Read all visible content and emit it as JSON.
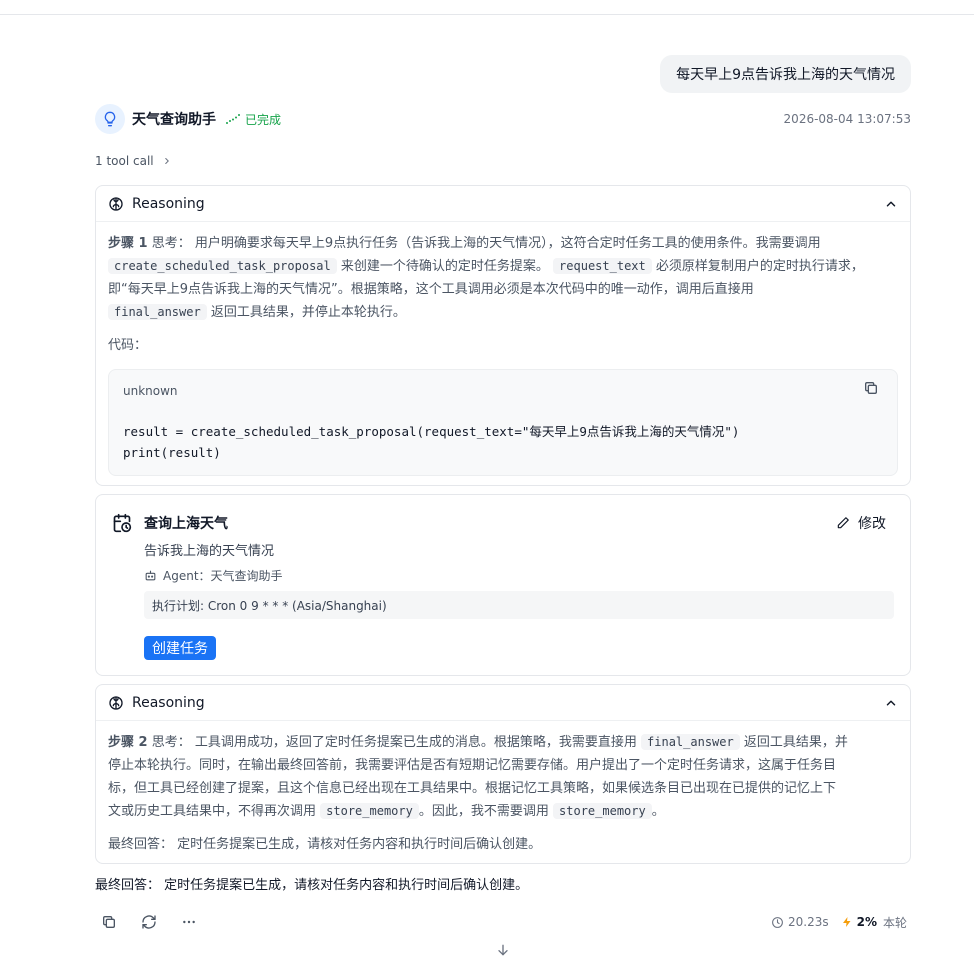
{
  "user_message": "每天早上9点告诉我上海的天气情况",
  "bot": {
    "name": "天气查询助手",
    "status": "已完成",
    "timestamp": "2026-08-04 13:07:53",
    "avatar_icon": "lightbulb-icon"
  },
  "tool_call": {
    "label": "1 tool call"
  },
  "reasoning1": {
    "title": "Reasoning",
    "step_label": "步骤 1",
    "think_label": "思考：",
    "p1": "用户明确要求每天早上9点执行任务（告诉我上海的天气情况），这符合定时任务工具的使用条件。我需要调用",
    "code1": "create_scheduled_task_proposal",
    "p2": "来创建一个待确认的定时任务提案。",
    "code2": "request_text",
    "p3": "必须原样复制用户的定时执行请求，",
    "p4": "即“每天早上9点告诉我上海的天气情况”。根据策略，这个工具调用必须是本次代码中的唯一动作，调用后直接用",
    "code3": "final_answer",
    "p5": "返回工具结果，并停止本轮执行。",
    "code_label": "代码：",
    "code_lang": "unknown",
    "code_line1": "result = create_scheduled_task_proposal(request_text=\"每天早上9点告诉我上海的天气情况\")",
    "code_line2": "print(result)"
  },
  "task": {
    "title": "查询上海天气",
    "edit_label": "修改",
    "description": "告诉我上海的天气情况",
    "agent": "Agent：天气查询助手",
    "schedule": "执行计划: Cron 0 9 * * * (Asia/Shanghai)",
    "create_label": "创建任务"
  },
  "reasoning2": {
    "title": "Reasoning",
    "step_label": "步骤 2",
    "think_label": "思考：",
    "p1": "工具调用成功，返回了定时任务提案已生成的消息。根据策略，我需要直接用",
    "code1": "final_answer",
    "p2": "返回工具结果，并",
    "p3": "停止本轮执行。同时，在输出最终回答前，我需要评估是否有短期记忆需要存储。用户提出了一个定时任务请求，这属于任务目",
    "p4": "标，但工具已经创建了提案，且这个信息已经出现在工具结果中。根据记忆工具策略，如果候选条目已出现在已提供的记忆上下",
    "p5": "文或历史工具结果中，不得再次调用",
    "code2": "store_memory",
    "p6": "。因此，我不需要调用",
    "code3": "store_memory",
    "p7": "。",
    "final_label": "最终回答：",
    "final_text": "定时任务提案已生成，请核对任务内容和执行时间后确认创建。"
  },
  "final_answer": {
    "label": "最终回答：",
    "text": "定时任务提案已生成，请核对任务内容和执行时间后确认创建。"
  },
  "stats": {
    "duration": "20.23s",
    "percent": "2%",
    "round_label": "本轮"
  },
  "colors": {
    "accent": "#1a73f5",
    "success": "#16a34a",
    "energy": "#f59e0b"
  }
}
